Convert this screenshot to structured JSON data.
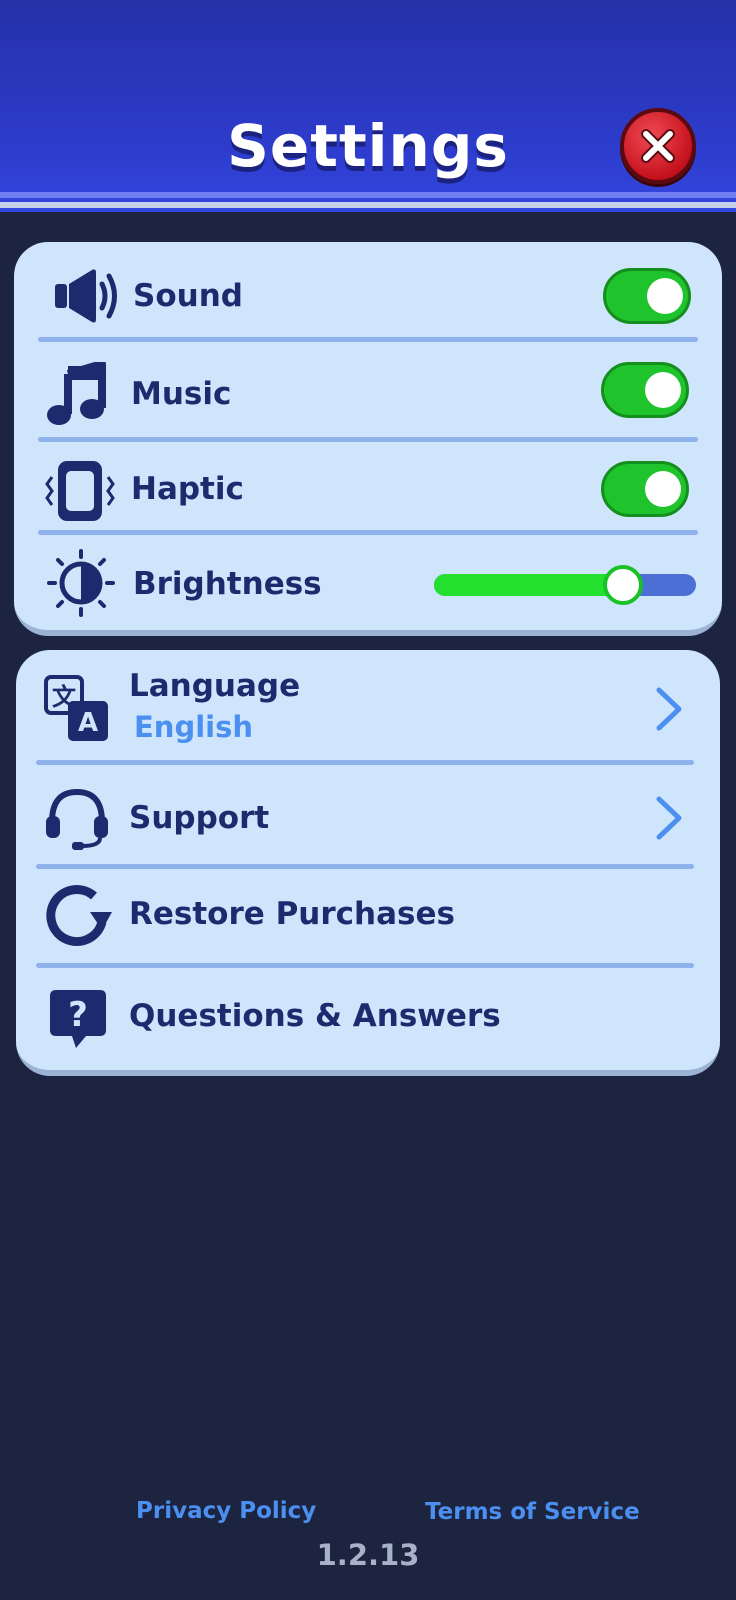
{
  "header": {
    "title": "Settings",
    "close_icon": "close-icon"
  },
  "toggles": {
    "sound": {
      "label": "Sound",
      "on": true,
      "icon": "speaker-icon"
    },
    "music": {
      "label": "Music",
      "on": true,
      "icon": "music-note-icon"
    },
    "haptic": {
      "label": "Haptic",
      "on": true,
      "icon": "vibrate-phone-icon"
    }
  },
  "brightness": {
    "label": "Brightness",
    "level": 0.72,
    "icon": "brightness-icon"
  },
  "menu": {
    "language": {
      "label": "Language",
      "value": "English",
      "icon": "translate-icon"
    },
    "support": {
      "label": "Support",
      "icon": "headset-icon"
    },
    "restore": {
      "label": "Restore Purchases",
      "icon": "restore-icon"
    },
    "qa": {
      "label": "Questions & Answers",
      "icon": "question-bubble-icon"
    }
  },
  "footer": {
    "privacy": "Privacy Policy",
    "terms": "Terms of Service",
    "version": "1.2.13"
  },
  "colors": {
    "header": "#2d3ccc",
    "background": "#1c2440",
    "card": "#cfe5fb",
    "toggle_on": "#1fc32b",
    "accent_text": "#4b8ff0",
    "label_text": "#1e2a6e",
    "close_button": "#d61824"
  }
}
